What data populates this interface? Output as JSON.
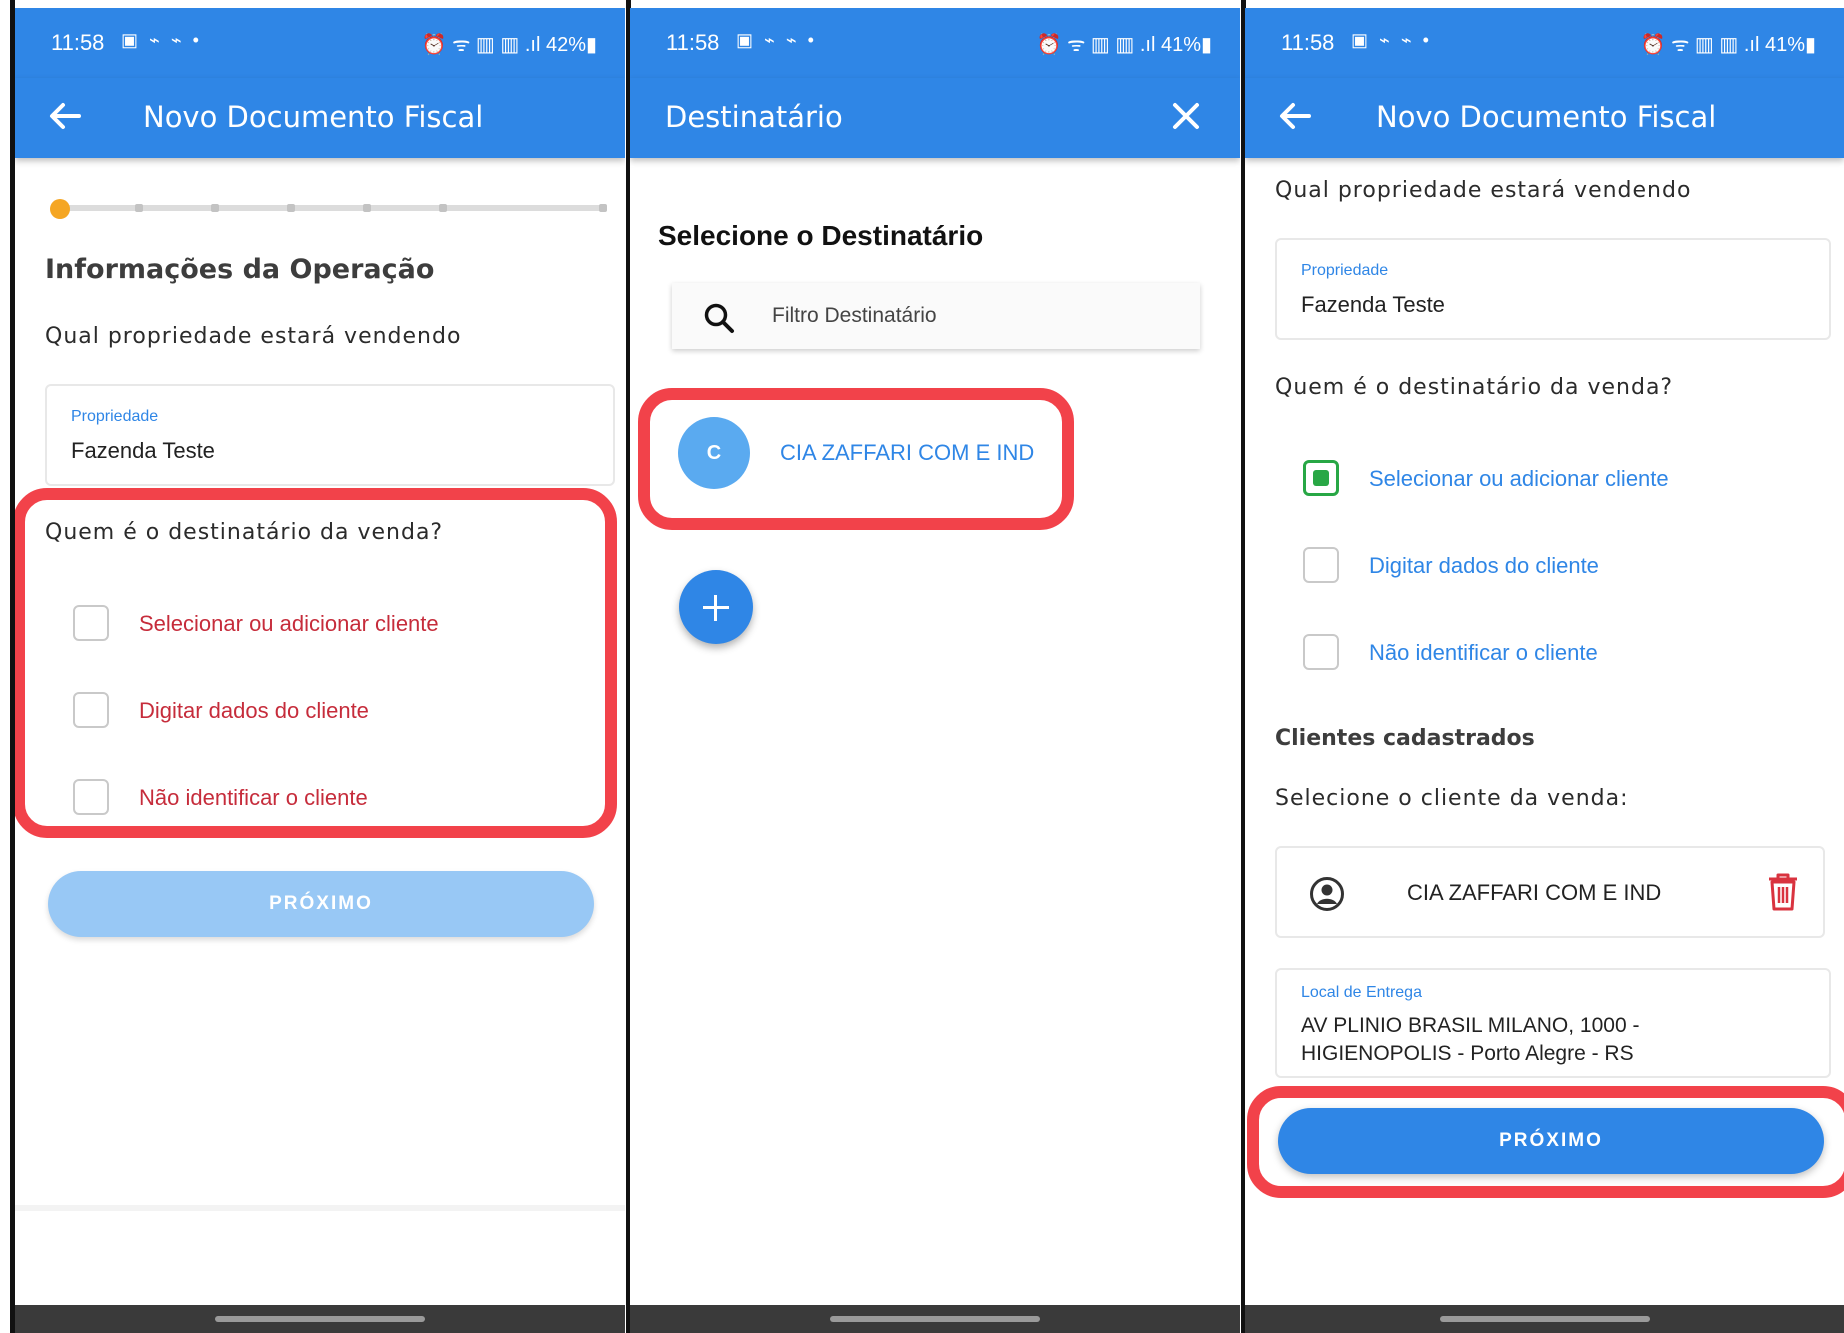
{
  "status": {
    "screen1": {
      "time": "11:58",
      "icons": "▣ ⌁ ⌁ •",
      "right": "⏰ ᯤ ▥ ▥ .ıl 42%▮"
    },
    "screen2": {
      "time": "11:58",
      "icons": "▣ ⌁ ⌁ •",
      "right": "⏰ ᯤ ▥ ▥ .ıl 41%▮"
    },
    "screen3": {
      "time": "11:58",
      "icons": "▣ ⌁ ⌁ •",
      "right": "⏰ ᯤ ▥ ▥ .ıl 41%▮"
    }
  },
  "screen1": {
    "title": "Novo Documento Fiscal",
    "progress": {
      "current_step": 1,
      "total_steps": 7
    },
    "section_heading": "Informações da Operação",
    "property_question": "Qual propriedade estará vendendo",
    "property_field": {
      "label": "Propriedade",
      "value": "Fazenda Teste"
    },
    "recipient_question": "Quem é o destinatário da venda?",
    "options": [
      {
        "label": "Selecionar ou adicionar cliente",
        "checked": false
      },
      {
        "label": "Digitar dados do cliente",
        "checked": false
      },
      {
        "label": "Não identificar o cliente",
        "checked": false
      }
    ],
    "next_button": "PRÓXIMO",
    "next_enabled": false
  },
  "screen2": {
    "title": "Destinatário",
    "heading": "Selecione o Destinatário",
    "search_placeholder": "Filtro Destinatário",
    "recipients": [
      {
        "initial": "C",
        "name": "CIA ZAFFARI COM E IND"
      }
    ]
  },
  "screen3": {
    "title": "Novo Documento Fiscal",
    "property_question": "Qual propriedade estará vendendo",
    "property_field": {
      "label": "Propriedade",
      "value": "Fazenda Teste"
    },
    "recipient_question": "Quem é o destinatário da venda?",
    "options": [
      {
        "label": "Selecionar ou adicionar cliente",
        "checked": true
      },
      {
        "label": "Digitar dados do cliente",
        "checked": false
      },
      {
        "label": "Não identificar o cliente",
        "checked": false
      }
    ],
    "registered_heading": "Clientes cadastrados",
    "select_client_prompt": "Selecione o cliente da venda:",
    "selected_client": "CIA ZAFFARI COM E IND",
    "delivery_field": {
      "label": "Local de Entrega",
      "line1": "AV PLINIO BRASIL MILANO, 1000 -",
      "line2": "HIGIENOPOLIS - Porto Alegre - RS"
    },
    "next_button": "PRÓXIMO",
    "next_enabled": true
  },
  "colors": {
    "primary": "#2f86e6",
    "disabled_button": "#98c8f5",
    "warning_text": "#c62c3b",
    "highlight": "#f2424a",
    "checked": "#28a745",
    "progress_current": "#f5a623"
  }
}
